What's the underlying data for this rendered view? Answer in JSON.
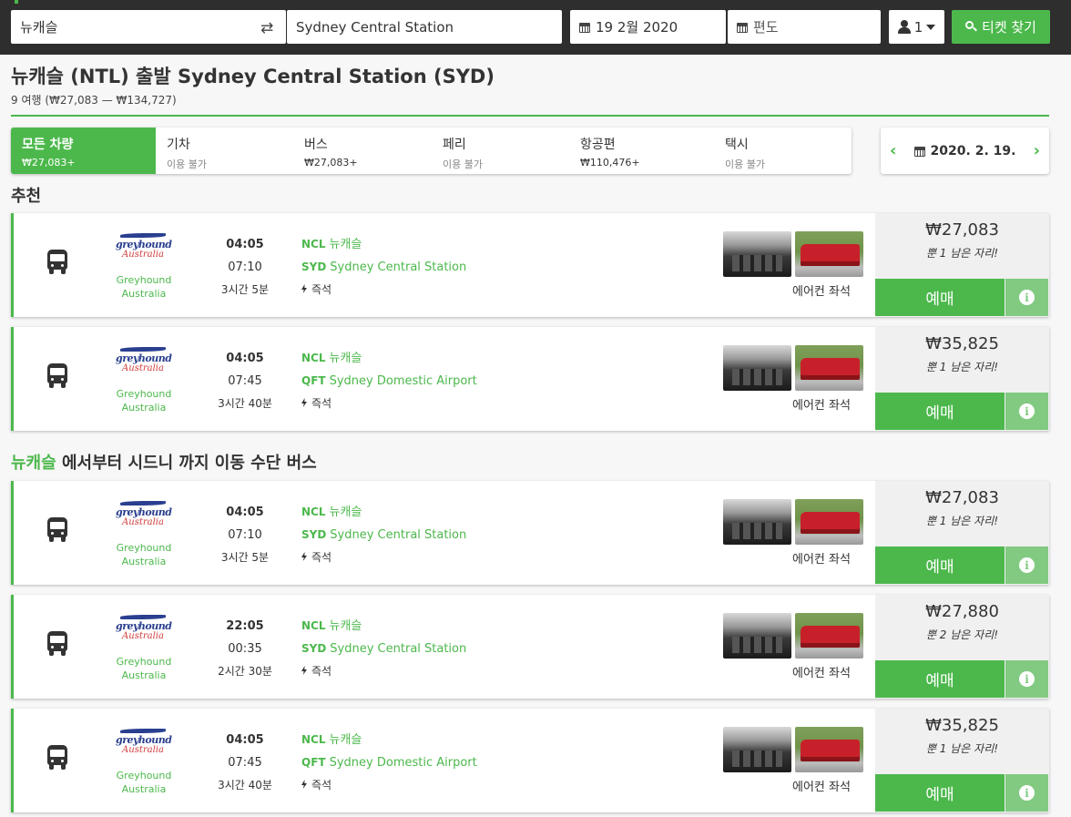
{
  "search": {
    "from": "뉴캐슬",
    "to": "Sydney Central Station",
    "date": "19 2월 2020",
    "return_placeholder": "편도",
    "passengers": "1",
    "button_label": "티켓 찾기"
  },
  "header": {
    "title": "뉴캐슬 (NTL) 출발 Sydney Central Station (SYD)",
    "summary": "9 여행 (₩27,083 — ₩134,727)"
  },
  "modes": [
    {
      "label": "모든 차량",
      "price": "₩27,083+"
    },
    {
      "label": "기차",
      "price": "이용 불가"
    },
    {
      "label": "버스",
      "price": "₩27,083+"
    },
    {
      "label": "페리",
      "price": "이용 불가"
    },
    {
      "label": "항공편",
      "price": "₩110,476+"
    },
    {
      "label": "택시",
      "price": "이용 불가"
    }
  ],
  "date_nav": {
    "date": "2020. 2. 19."
  },
  "sections": {
    "recommended": "추천",
    "bus_prefix": "뉴캐슬",
    "bus_rest": " 에서부터 시드니 까지 이동 수단 버스"
  },
  "labels": {
    "operator": "Greyhound Australia",
    "logo_word": "greyhound",
    "logo_sub": "Australia",
    "instant": "즉석",
    "amenity": "에어컨 좌석",
    "book": "예매",
    "info": "i"
  },
  "trips": [
    {
      "dep": "04:05",
      "arr": "07:10",
      "dur": "3시간 5분",
      "from_code": "NCL",
      "from": "뉴캐슬",
      "to_code": "SYD",
      "to": "Sydney Central Station",
      "price": "₩27,083",
      "seats": "뿐 1 남은 자리!"
    },
    {
      "dep": "04:05",
      "arr": "07:45",
      "dur": "3시간 40분",
      "from_code": "NCL",
      "from": "뉴캐슬",
      "to_code": "QFT",
      "to": "Sydney Domestic Airport",
      "price": "₩35,825",
      "seats": "뿐 1 남은 자리!"
    },
    {
      "dep": "04:05",
      "arr": "07:10",
      "dur": "3시간 5분",
      "from_code": "NCL",
      "from": "뉴캐슬",
      "to_code": "SYD",
      "to": "Sydney Central Station",
      "price": "₩27,083",
      "seats": "뿐 1 남은 자리!"
    },
    {
      "dep": "22:05",
      "arr": "00:35",
      "dur": "2시간 30분",
      "from_code": "NCL",
      "from": "뉴캐슬",
      "to_code": "SYD",
      "to": "Sydney Central Station",
      "price": "₩27,880",
      "seats": "뿐 2 남은 자리!"
    },
    {
      "dep": "04:05",
      "arr": "07:45",
      "dur": "3시간 40분",
      "from_code": "NCL",
      "from": "뉴캐슬",
      "to_code": "QFT",
      "to": "Sydney Domestic Airport",
      "price": "₩35,825",
      "seats": "뿐 1 남은 자리!"
    }
  ],
  "colors": {
    "accent": "#4cb84c",
    "topbar": "#2e2e2e",
    "info_button": "#82ca82"
  }
}
